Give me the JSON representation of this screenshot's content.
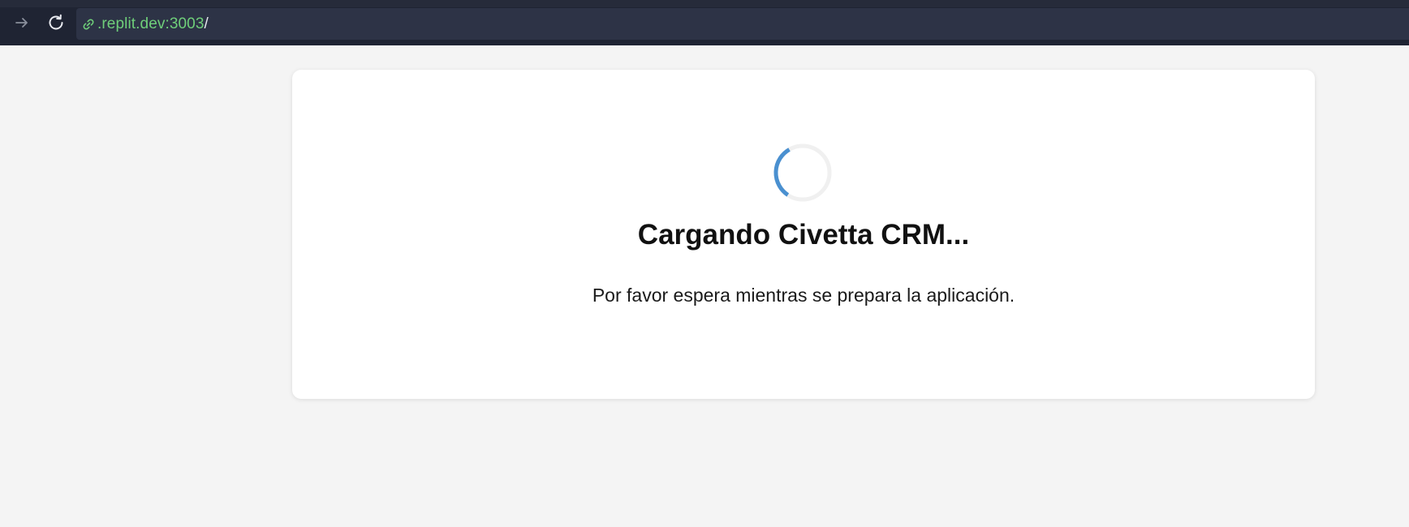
{
  "browser": {
    "url_host": ".replit.dev:3003",
    "url_path": "/",
    "icons": {
      "forward": "arrow-right-icon",
      "reload": "reload-icon",
      "link": "link-icon"
    },
    "colors": {
      "toolbar_bg": "#1f2433",
      "url_host": "#6fcf7a"
    }
  },
  "loading": {
    "title": "Cargando Civetta CRM...",
    "message": "Por favor espera mientras se prepara la aplicación.",
    "spinner_color": "#4a90d0"
  }
}
